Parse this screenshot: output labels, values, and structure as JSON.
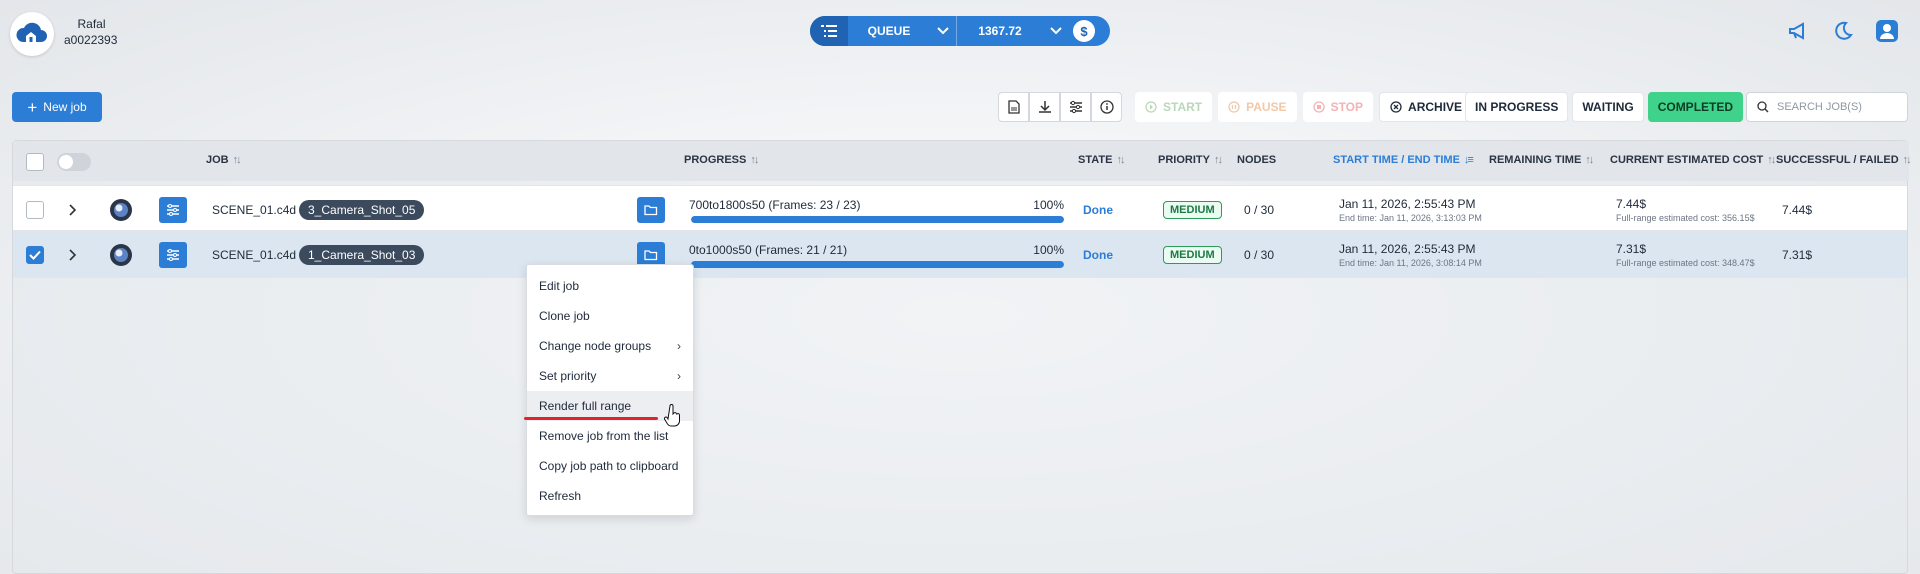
{
  "header": {
    "user_name": "Rafal",
    "user_id": "a0022393",
    "queue_label": "QUEUE",
    "balance": "1367.72"
  },
  "toolbar": {
    "new_job": "New job",
    "start": "START",
    "pause": "PAUSE",
    "stop": "STOP",
    "archive": "ARCHIVE",
    "filters": [
      "IN PROGRESS",
      "WAITING",
      "COMPLETED"
    ],
    "active_filter": "COMPLETED",
    "search_placeholder": "SEARCH JOB(S)"
  },
  "table": {
    "headers": {
      "job": "JOB",
      "progress": "PROGRESS",
      "state": "STATE",
      "priority": "PRIORITY",
      "nodes": "NODES",
      "time": "START TIME / END TIME",
      "remaining": "REMAINING TIME",
      "cost": "CURRENT ESTIMATED COST",
      "succ": "SUCCESSFUL / FAILED"
    },
    "rows": [
      {
        "checked": false,
        "file": "SCENE_01.c4d",
        "camera": "3_Camera_Shot_05",
        "progress_label": "700to1800s50 (Frames: 23 / 23)",
        "progress_pct": "100%",
        "progress": 1.0,
        "state": "Done",
        "priority": "MEDIUM",
        "nodes": "0 / 30",
        "start_time": "Jan 11, 2026, 2:55:43 PM",
        "end_time": "End time: Jan 11, 2026, 3:13:03 PM",
        "cost": "7.44$",
        "full_range_cost": "Full-range estimated cost: 356.15$",
        "succ": "7.44$"
      },
      {
        "checked": true,
        "file": "SCENE_01.c4d",
        "camera": "1_Camera_Shot_03",
        "progress_label": "0to1000s50 (Frames: 21 / 21)",
        "progress_pct": "100%",
        "progress": 1.0,
        "state": "Done",
        "priority": "MEDIUM",
        "nodes": "0 / 30",
        "start_time": "Jan 11, 2026, 2:55:43 PM",
        "end_time": "End time: Jan 11, 2026, 3:08:14 PM",
        "cost": "7.31$",
        "full_range_cost": "Full-range estimated cost: 348.47$",
        "succ": "7.31$"
      }
    ]
  },
  "context_menu": {
    "items": [
      "Edit job",
      "Clone job",
      "Change node groups",
      "Set priority",
      "Render full range",
      "Remove job from the list",
      "Copy job path to clipboard",
      "Refresh"
    ],
    "hovered": "Render full range"
  },
  "colors": {
    "accent": "#2b7dd6",
    "completed": "#3fd28a",
    "highlight_underline": "#e0242b"
  }
}
